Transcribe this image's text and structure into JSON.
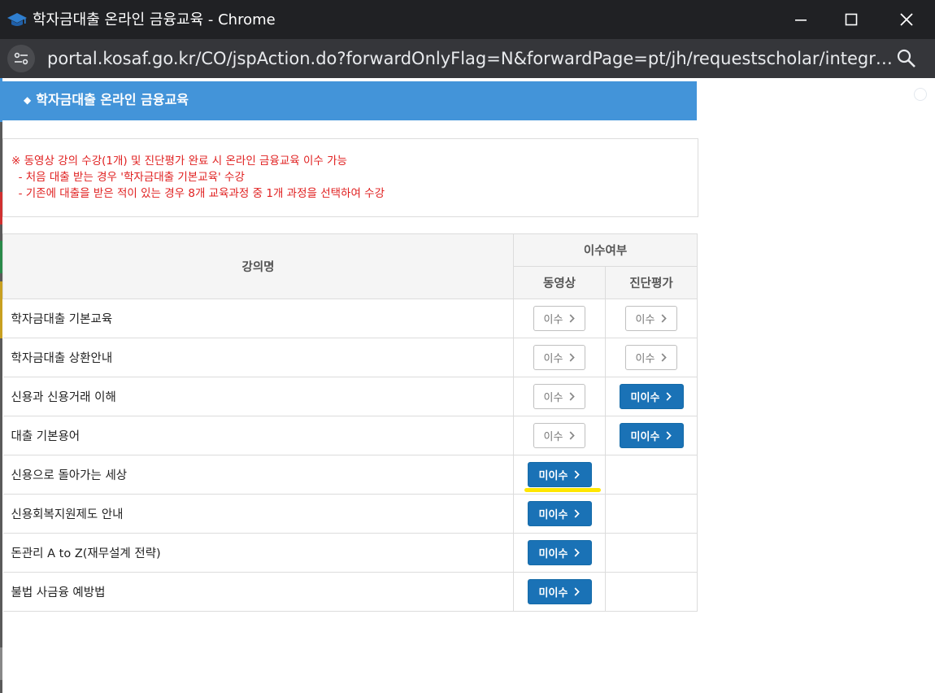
{
  "window": {
    "title": "학자금대출 온라인 금융교육 - Chrome",
    "url": "portal.kosaf.go.kr/CO/jspAction.do?forwardOnlyFlag=N&forwardPage=pt/jh/requestscholar/integrationApp..."
  },
  "header": {
    "bullet": "◆",
    "title": "학자금대출 온라인 금융교육"
  },
  "notice": [
    "※ 동영상 강의 수강(1개) 및 진단평가 완료 시 온라인 금융교육 이수 가능",
    "  - 처음 대출 받는 경우 '학자금대출 기본교육' 수강",
    "  - 기존에 대출을 받은 적이 있는 경우 8개 교육과정 중 1개 과정을 선택하여 수강"
  ],
  "table": {
    "col_course": "강의명",
    "col_status": "이수여부",
    "col_video": "동영상",
    "col_test": "진단평가",
    "rows": [
      {
        "name": "학자금대출 기본교육",
        "video": "이수",
        "test": "이수"
      },
      {
        "name": "학자금대출 상환안내",
        "video": "이수",
        "test": "이수"
      },
      {
        "name": "신용과 신용거래 이해",
        "video": "이수",
        "test": "미이수"
      },
      {
        "name": "대출 기본용어",
        "video": "이수",
        "test": "미이수"
      },
      {
        "name": "신용으로 돌아가는 세상",
        "video": "미이수",
        "test": ""
      },
      {
        "name": "신용회복지원제도 안내",
        "video": "미이수",
        "test": ""
      },
      {
        "name": "돈관리 A to Z(재무설계 전략)",
        "video": "미이수",
        "test": ""
      },
      {
        "name": "불법 사금융 예방법",
        "video": "미이수",
        "test": ""
      }
    ]
  },
  "colors": {
    "header_blue": "#4394d9",
    "button_blue": "#1a72b6",
    "notice_red": "#e02020",
    "highlight_yellow": "#ffe600"
  },
  "icons": {
    "app": "graduation-cap-icon",
    "site_info": "tune-icon",
    "zoom": "zoom-icon"
  }
}
